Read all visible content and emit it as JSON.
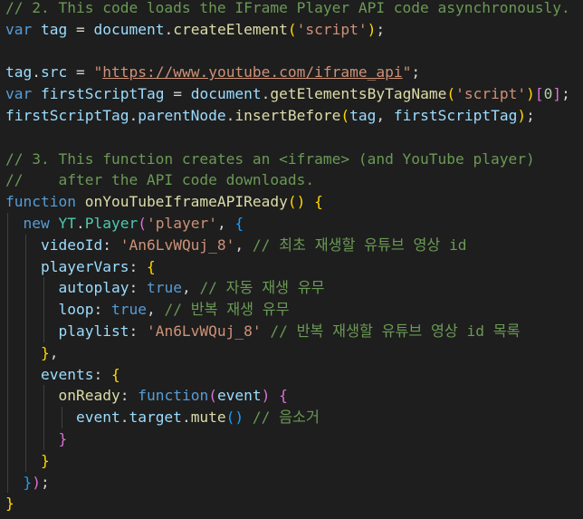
{
  "editor": {
    "language": "javascript",
    "theme": "dark",
    "lines": [
      [
        [
          "comment",
          "// 2. This code loads the IFrame Player API code asynchronously."
        ]
      ],
      [
        [
          "keyword",
          "var"
        ],
        [
          "plain",
          " "
        ],
        [
          "var",
          "tag"
        ],
        [
          "plain",
          " = "
        ],
        [
          "var",
          "document"
        ],
        [
          "plain",
          "."
        ],
        [
          "func",
          "createElement"
        ],
        [
          "brace-gold",
          "("
        ],
        [
          "string",
          "'script'"
        ],
        [
          "brace-gold",
          ")"
        ],
        [
          "plain",
          ";"
        ]
      ],
      [],
      [
        [
          "var",
          "tag"
        ],
        [
          "plain",
          "."
        ],
        [
          "var",
          "src"
        ],
        [
          "plain",
          " = "
        ],
        [
          "string",
          "\""
        ],
        [
          "url",
          "https://www.youtube.com/iframe_api"
        ],
        [
          "string",
          "\""
        ],
        [
          "plain",
          ";"
        ]
      ],
      [
        [
          "keyword",
          "var"
        ],
        [
          "plain",
          " "
        ],
        [
          "var",
          "firstScriptTag"
        ],
        [
          "plain",
          " = "
        ],
        [
          "var",
          "document"
        ],
        [
          "plain",
          "."
        ],
        [
          "func",
          "getElementsByTagName"
        ],
        [
          "brace-gold",
          "("
        ],
        [
          "string",
          "'script'"
        ],
        [
          "brace-gold",
          ")"
        ],
        [
          "brace-purple",
          "["
        ],
        [
          "number",
          "0"
        ],
        [
          "brace-purple",
          "]"
        ],
        [
          "plain",
          ";"
        ]
      ],
      [
        [
          "var",
          "firstScriptTag"
        ],
        [
          "plain",
          "."
        ],
        [
          "var",
          "parentNode"
        ],
        [
          "plain",
          "."
        ],
        [
          "func",
          "insertBefore"
        ],
        [
          "brace-gold",
          "("
        ],
        [
          "var",
          "tag"
        ],
        [
          "plain",
          ", "
        ],
        [
          "var",
          "firstScriptTag"
        ],
        [
          "brace-gold",
          ")"
        ],
        [
          "plain",
          ";"
        ]
      ],
      [],
      [
        [
          "comment",
          "// 3. This function creates an <iframe> (and YouTube player)"
        ]
      ],
      [
        [
          "comment",
          "//    after the API code downloads."
        ]
      ],
      [
        [
          "keyword",
          "function"
        ],
        [
          "plain",
          " "
        ],
        [
          "func",
          "onYouTubeIframeAPIReady"
        ],
        [
          "brace-gold",
          "()"
        ],
        [
          "plain",
          " "
        ],
        [
          "brace-gold",
          "{"
        ]
      ],
      [
        [
          "plain",
          "  "
        ],
        [
          "keyword",
          "new"
        ],
        [
          "plain",
          " "
        ],
        [
          "class",
          "YT"
        ],
        [
          "plain",
          "."
        ],
        [
          "class",
          "Player"
        ],
        [
          "brace-purple",
          "("
        ],
        [
          "string",
          "'player'"
        ],
        [
          "plain",
          ", "
        ],
        [
          "brace-blue",
          "{"
        ]
      ],
      [
        [
          "plain",
          "    "
        ],
        [
          "var",
          "videoId"
        ],
        [
          "plain",
          ": "
        ],
        [
          "string",
          "'An6LvWQuj_8'"
        ],
        [
          "plain",
          ", "
        ],
        [
          "comment",
          "// 최초 재생할 유튜브 영상 id"
        ]
      ],
      [
        [
          "plain",
          "    "
        ],
        [
          "var",
          "playerVars"
        ],
        [
          "plain",
          ": "
        ],
        [
          "brace-gold",
          "{"
        ]
      ],
      [
        [
          "plain",
          "      "
        ],
        [
          "var",
          "autoplay"
        ],
        [
          "plain",
          ": "
        ],
        [
          "keyword",
          "true"
        ],
        [
          "plain",
          ", "
        ],
        [
          "comment",
          "// 자동 재생 유무"
        ]
      ],
      [
        [
          "plain",
          "      "
        ],
        [
          "var",
          "loop"
        ],
        [
          "plain",
          ": "
        ],
        [
          "keyword",
          "true"
        ],
        [
          "plain",
          ", "
        ],
        [
          "comment",
          "// 반복 재생 유무"
        ]
      ],
      [
        [
          "plain",
          "      "
        ],
        [
          "var",
          "playlist"
        ],
        [
          "plain",
          ": "
        ],
        [
          "string",
          "'An6LvWQuj_8'"
        ],
        [
          "plain",
          " "
        ],
        [
          "comment",
          "// 반복 재생할 유튜브 영상 id 목록"
        ]
      ],
      [
        [
          "plain",
          "    "
        ],
        [
          "brace-gold",
          "}"
        ],
        [
          "plain",
          ","
        ]
      ],
      [
        [
          "plain",
          "    "
        ],
        [
          "var",
          "events"
        ],
        [
          "plain",
          ": "
        ],
        [
          "brace-gold",
          "{"
        ]
      ],
      [
        [
          "plain",
          "      "
        ],
        [
          "func",
          "onReady"
        ],
        [
          "plain",
          ": "
        ],
        [
          "keyword",
          "function"
        ],
        [
          "brace-purple",
          "("
        ],
        [
          "var",
          "event"
        ],
        [
          "brace-purple",
          ")"
        ],
        [
          "plain",
          " "
        ],
        [
          "brace-purple",
          "{"
        ]
      ],
      [
        [
          "plain",
          "        "
        ],
        [
          "var",
          "event"
        ],
        [
          "plain",
          "."
        ],
        [
          "var",
          "target"
        ],
        [
          "plain",
          "."
        ],
        [
          "func",
          "mute"
        ],
        [
          "brace-blue",
          "()"
        ],
        [
          "plain",
          " "
        ],
        [
          "comment",
          "// 음소거"
        ]
      ],
      [
        [
          "plain",
          "      "
        ],
        [
          "brace-purple",
          "}"
        ]
      ],
      [
        [
          "plain",
          "    "
        ],
        [
          "brace-gold",
          "}"
        ]
      ],
      [
        [
          "plain",
          "  "
        ],
        [
          "brace-blue",
          "}"
        ],
        [
          "brace-purple",
          ")"
        ],
        [
          "plain",
          ";"
        ]
      ],
      [
        [
          "brace-gold",
          "}"
        ]
      ]
    ]
  }
}
